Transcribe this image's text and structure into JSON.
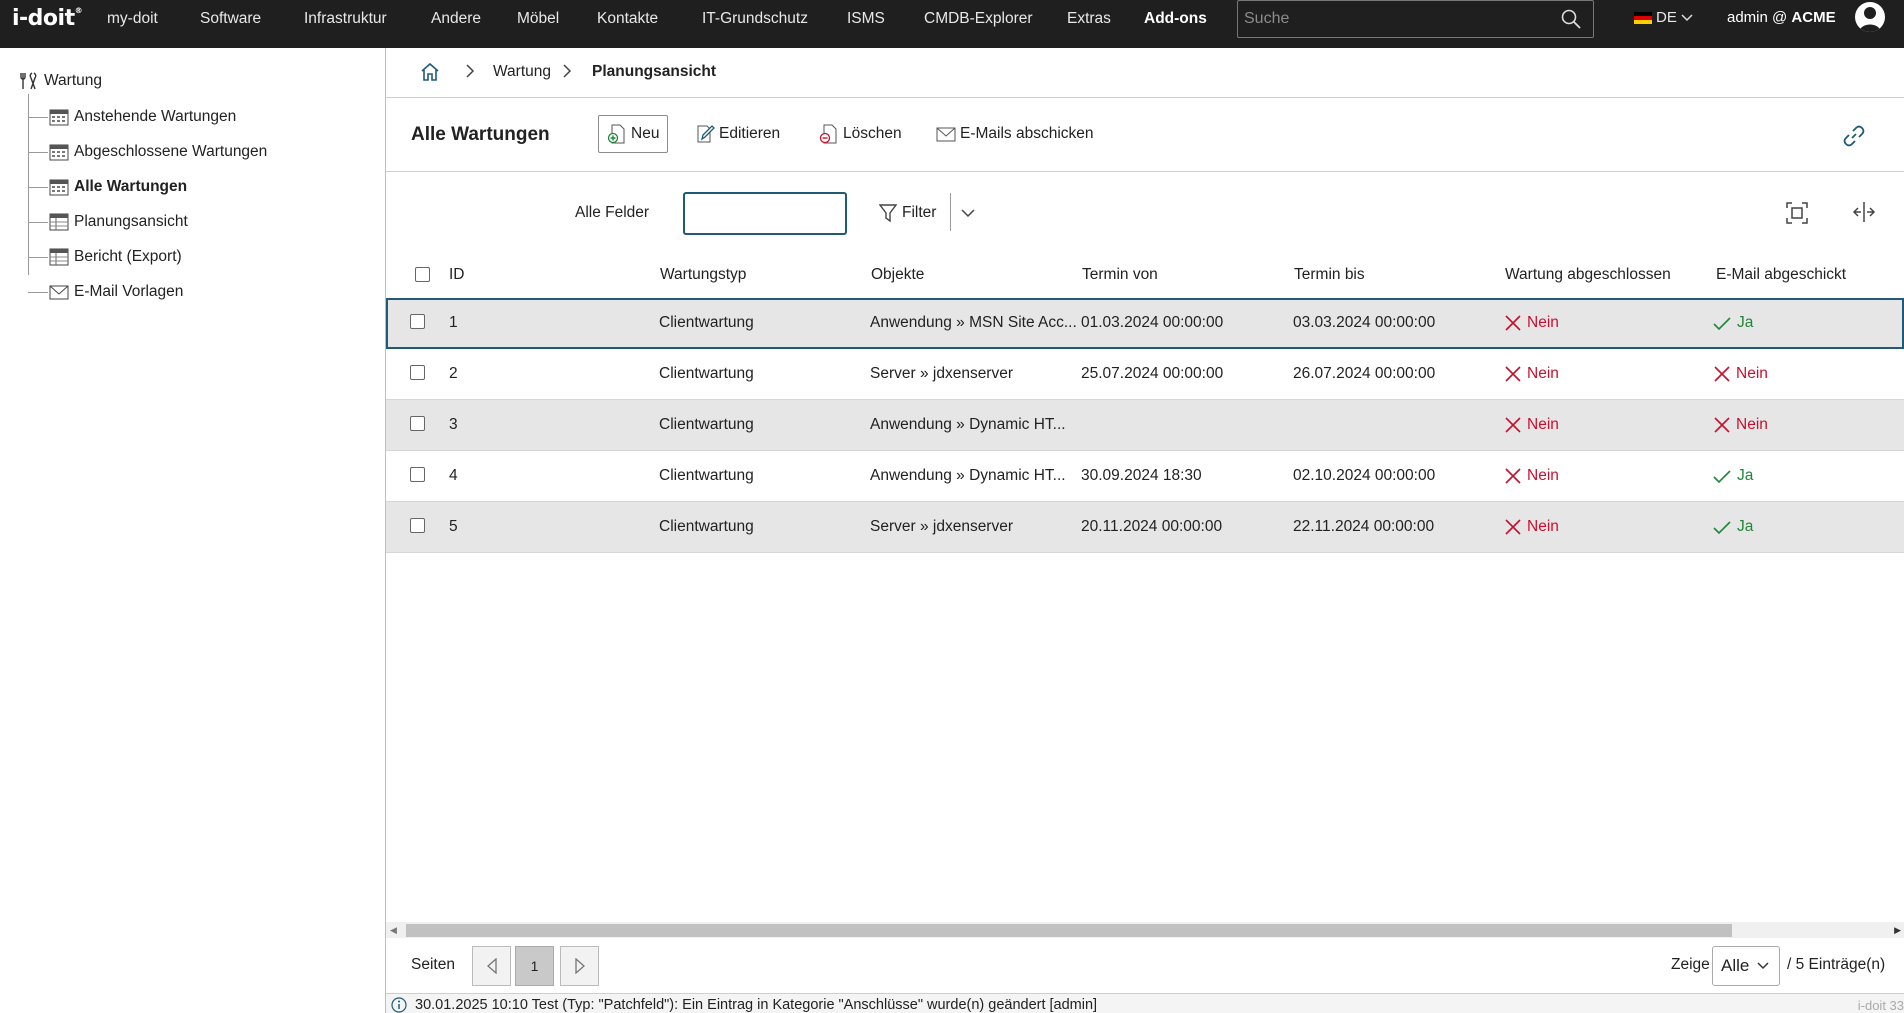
{
  "app": {
    "logo": "i-doit"
  },
  "nav": {
    "items": [
      "my-doit",
      "Software",
      "Infrastruktur",
      "Andere",
      "Möbel",
      "Kontakte",
      "IT-Grundschutz",
      "ISMS",
      "CMDB-Explorer",
      "Extras",
      "Add-ons"
    ],
    "active": "Add-ons",
    "search_placeholder": "Suche",
    "language": "DE",
    "user": "admin @",
    "tenant": "ACME"
  },
  "sidebar": {
    "root": "Wartung",
    "items": [
      {
        "label": "Anstehende Wartungen",
        "icon": "calendar-icon"
      },
      {
        "label": "Abgeschlossene Wartungen",
        "icon": "calendar-icon"
      },
      {
        "label": "Alle Wartungen",
        "icon": "calendar-icon",
        "active": true
      },
      {
        "label": "Planungsansicht",
        "icon": "table-icon"
      },
      {
        "label": "Bericht (Export)",
        "icon": "table-icon"
      },
      {
        "label": "E-Mail Vorlagen",
        "icon": "mail-icon"
      }
    ]
  },
  "breadcrumb": {
    "items": [
      "Wartung",
      "Planungsansicht"
    ]
  },
  "toolbar": {
    "title": "Alle Wartungen",
    "new_label": "Neu",
    "edit_label": "Editieren",
    "delete_label": "Löschen",
    "email_label": "E-Mails abschicken"
  },
  "filter": {
    "label": "Alle Felder",
    "value": "",
    "button_label": "Filter"
  },
  "table": {
    "columns": [
      "ID",
      "Wartungstyp",
      "Objekte",
      "Termin von",
      "Termin bis",
      "Wartung abgeschlossen",
      "E-Mail abgeschickt"
    ],
    "rows": [
      {
        "id": "1",
        "type": "Clientwartung",
        "objects": "Anwendung » MSN Site Acc...",
        "from": "01.03.2024 00:00:00",
        "to": "03.03.2024 00:00:00",
        "done": "Nein",
        "mail": "Ja"
      },
      {
        "id": "2",
        "type": "Clientwartung",
        "objects": "Server » jdxenserver",
        "from": "25.07.2024 00:00:00",
        "to": "26.07.2024 00:00:00",
        "done": "Nein",
        "mail": "Nein"
      },
      {
        "id": "3",
        "type": "Clientwartung",
        "objects": "Anwendung » Dynamic HT...",
        "from": "",
        "to": "",
        "done": "Nein",
        "mail": "Nein"
      },
      {
        "id": "4",
        "type": "Clientwartung",
        "objects": "Anwendung » Dynamic HT...",
        "from": "30.09.2024 18:30",
        "to": "02.10.2024 00:00:00",
        "done": "Nein",
        "mail": "Ja"
      },
      {
        "id": "5",
        "type": "Clientwartung",
        "objects": "Server » jdxenserver",
        "from": "20.11.2024 00:00:00",
        "to": "22.11.2024 00:00:00",
        "done": "Nein",
        "mail": "Ja"
      }
    ]
  },
  "pager": {
    "pages_label": "Seiten",
    "current_page": "1",
    "show_label": "Zeige",
    "show_value": "Alle",
    "count_label": "/ 5 Einträge(n)"
  },
  "status": {
    "message": "30.01.2025 10:10 Test (Typ: \"Patchfeld\"): Ein Eintrag in Kategorie \"Anschlüsse\" wurde(n) geändert [admin]",
    "version": "i-doit 33"
  },
  "colors": {
    "nav_bg": "#1f1f1f",
    "accent": "#1f5b77",
    "no": "#c8102e",
    "yes": "#22863a",
    "row_shade": "#e6e6e6"
  }
}
